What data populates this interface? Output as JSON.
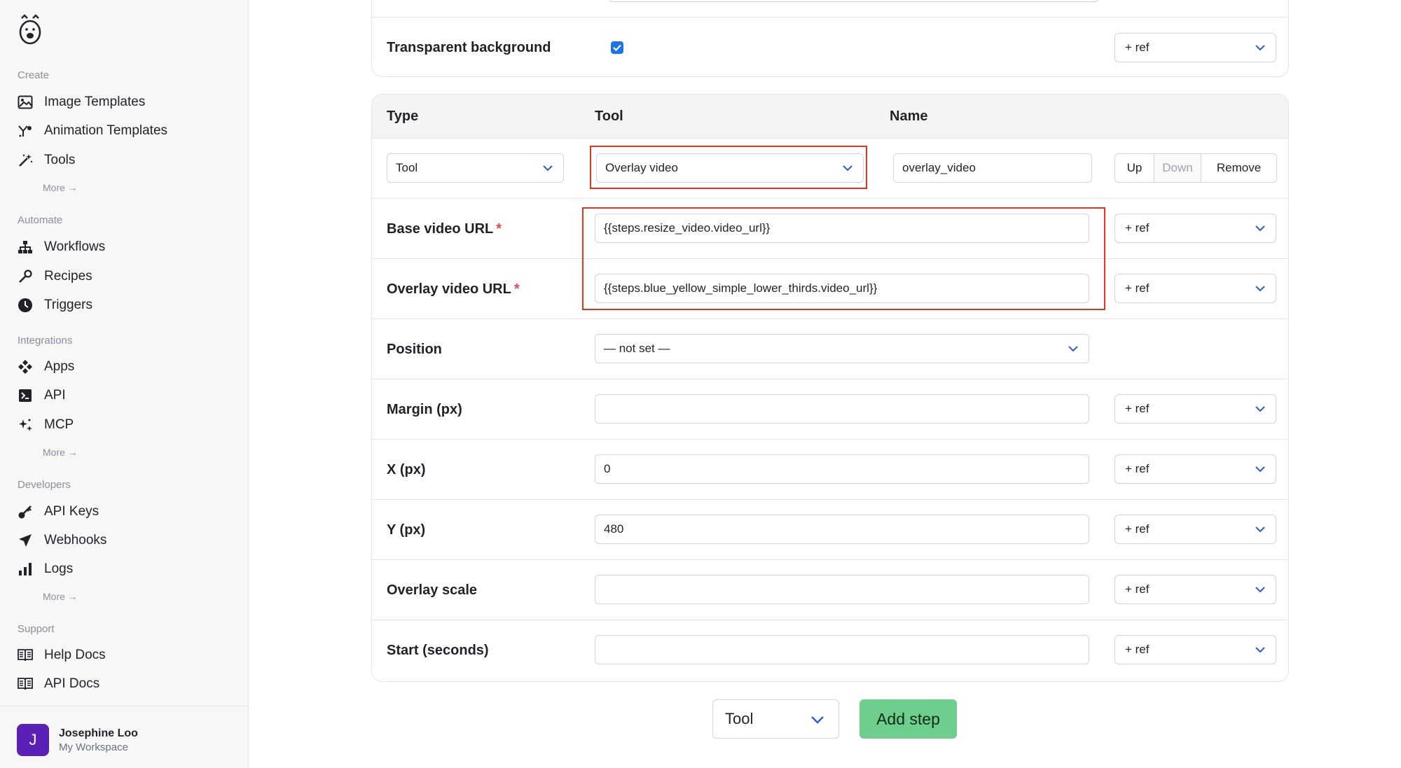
{
  "sidebar": {
    "sections": {
      "create": "Create",
      "automate": "Automate",
      "integrations": "Integrations",
      "developers": "Developers",
      "support": "Support"
    },
    "create_items": [
      "Image Templates",
      "Animation Templates",
      "Tools"
    ],
    "automate_items": [
      "Workflows",
      "Recipes",
      "Triggers"
    ],
    "integrations_items": [
      "Apps",
      "API",
      "MCP"
    ],
    "developers_items": [
      "API Keys",
      "Webhooks",
      "Logs"
    ],
    "support_items": [
      "Help Docs",
      "API Docs"
    ],
    "more_label": "More →",
    "user": {
      "initial": "J",
      "name": "Josephine Loo",
      "workspace": "My Workspace"
    }
  },
  "top_panel": {
    "transparent_label": "Transparent background",
    "transparent_checked": true
  },
  "step": {
    "headers": {
      "type": "Type",
      "tool": "Tool",
      "name": "Name"
    },
    "type_value": "Tool",
    "tool_value": "Overlay video",
    "name_value": "overlay_video",
    "buttons": {
      "up": "Up",
      "down": "Down",
      "remove": "Remove"
    },
    "ref_label": "+ ref",
    "fields": {
      "base_video_url": {
        "label": "Base video URL",
        "required": "*",
        "value": "{{steps.resize_video.video_url}}"
      },
      "overlay_video_url": {
        "label": "Overlay video URL",
        "required": "*",
        "value": "{{steps.blue_yellow_simple_lower_thirds.video_url}}"
      },
      "position": {
        "label": "Position",
        "value": "— not set —"
      },
      "margin": {
        "label": "Margin (px)",
        "value": ""
      },
      "x": {
        "label": "X (px)",
        "value": "0"
      },
      "y": {
        "label": "Y (px)",
        "value": "480"
      },
      "overlay_scale": {
        "label": "Overlay scale",
        "value": ""
      },
      "start": {
        "label": "Start (seconds)",
        "value": ""
      }
    }
  },
  "footer_controls": {
    "step_type": "Tool",
    "add_step_label": "Add step"
  },
  "colors": {
    "accent_blue": "#1a73e8",
    "highlight_red": "#e5341f",
    "add_step_green": "#6ece8e",
    "avatar_purple": "#5b21b6"
  }
}
